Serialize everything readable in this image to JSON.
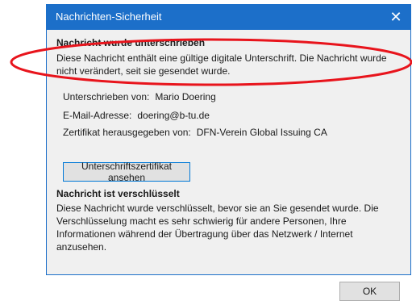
{
  "window": {
    "title": "Nachrichten-Sicherheit",
    "close_glyph": "✕"
  },
  "signature": {
    "heading": "Nachricht wurde unterschrieben",
    "description": "Diese Nachricht enthält eine gültige digitale Unterschrift. Die Nachricht wurde nicht verändert, seit sie gesendet wurde.",
    "signed_by_label": "Unterschrieben von:",
    "signed_by_value": "Mario Doering",
    "email_label": "E-Mail-Adresse:",
    "email_value": "doering@b-tu.de",
    "issuer_label": "Zertifikat herausgegeben von:",
    "issuer_value": "DFN-Verein Global Issuing CA",
    "view_cert_button": "Unterschriftszertifikat ansehen"
  },
  "encryption": {
    "heading": "Nachricht ist verschlüsselt",
    "description": "Diese Nachricht wurde verschlüsselt, bevor sie an Sie gesendet wurde. Die Verschlüsselung macht es sehr schwierig für andere Personen, Ihre Informationen während der Übertragung über das Netzwerk / Internet anzusehen."
  },
  "footer": {
    "ok_button": "OK"
  },
  "colors": {
    "titlebar": "#1c6fc9",
    "annotation": "#e8141c"
  }
}
